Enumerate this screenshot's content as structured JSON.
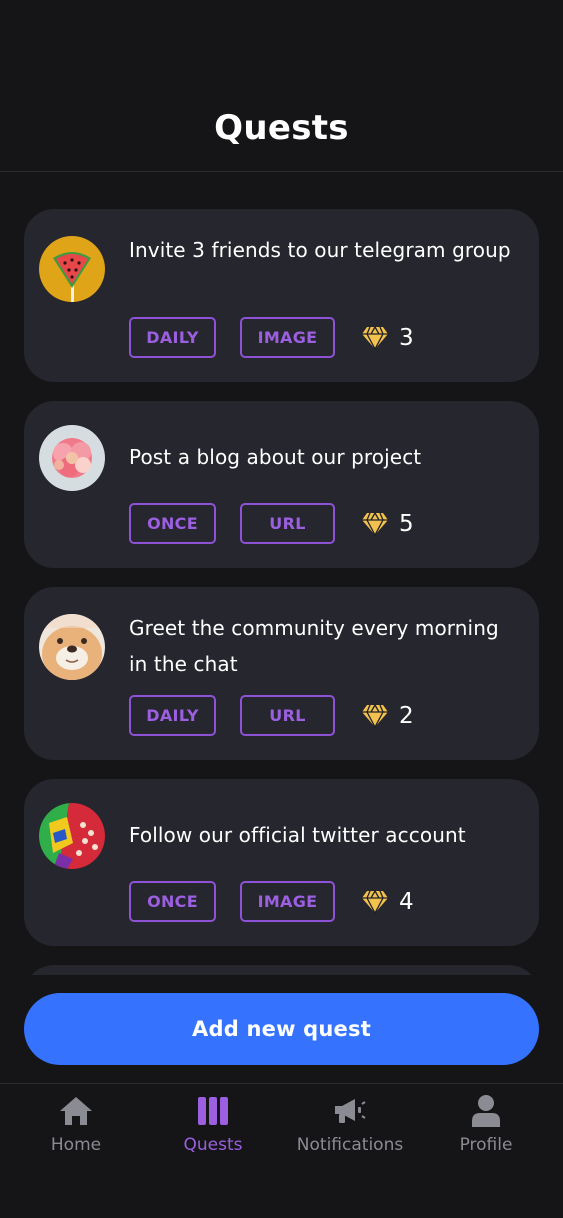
{
  "header": {
    "title": "Quests"
  },
  "quests": [
    {
      "title": "Invite 3 friends to our telegram group",
      "frequency": "DAILY",
      "type": "IMAGE",
      "reward": "3",
      "avatar": "watermelon-lollipop"
    },
    {
      "title": "Post a blog about our project",
      "frequency": "ONCE",
      "type": "URL",
      "reward": "5",
      "avatar": "pink-flower"
    },
    {
      "title": "Greet the community every morning in the chat",
      "frequency": "DAILY",
      "type": "URL",
      "reward": "2",
      "avatar": "seal"
    },
    {
      "title": "Follow our official twitter account",
      "frequency": "ONCE",
      "type": "IMAGE",
      "reward": "4",
      "avatar": "colorful-face-art"
    }
  ],
  "add_button": {
    "label": "Add new quest"
  },
  "nav": {
    "items": [
      {
        "label": "Home",
        "icon": "home-icon",
        "active": false
      },
      {
        "label": "Quests",
        "icon": "quests-icon",
        "active": true
      },
      {
        "label": "Notifications",
        "icon": "megaphone-icon",
        "active": false
      },
      {
        "label": "Profile",
        "icon": "person-icon",
        "active": false
      }
    ]
  },
  "colors": {
    "background": "#151517",
    "card": "#25262e",
    "accent_purple": "#9b5fe0",
    "primary_blue": "#3573ff",
    "gem_yellow": "#f2c14e",
    "muted_text": "#8a8b93"
  }
}
